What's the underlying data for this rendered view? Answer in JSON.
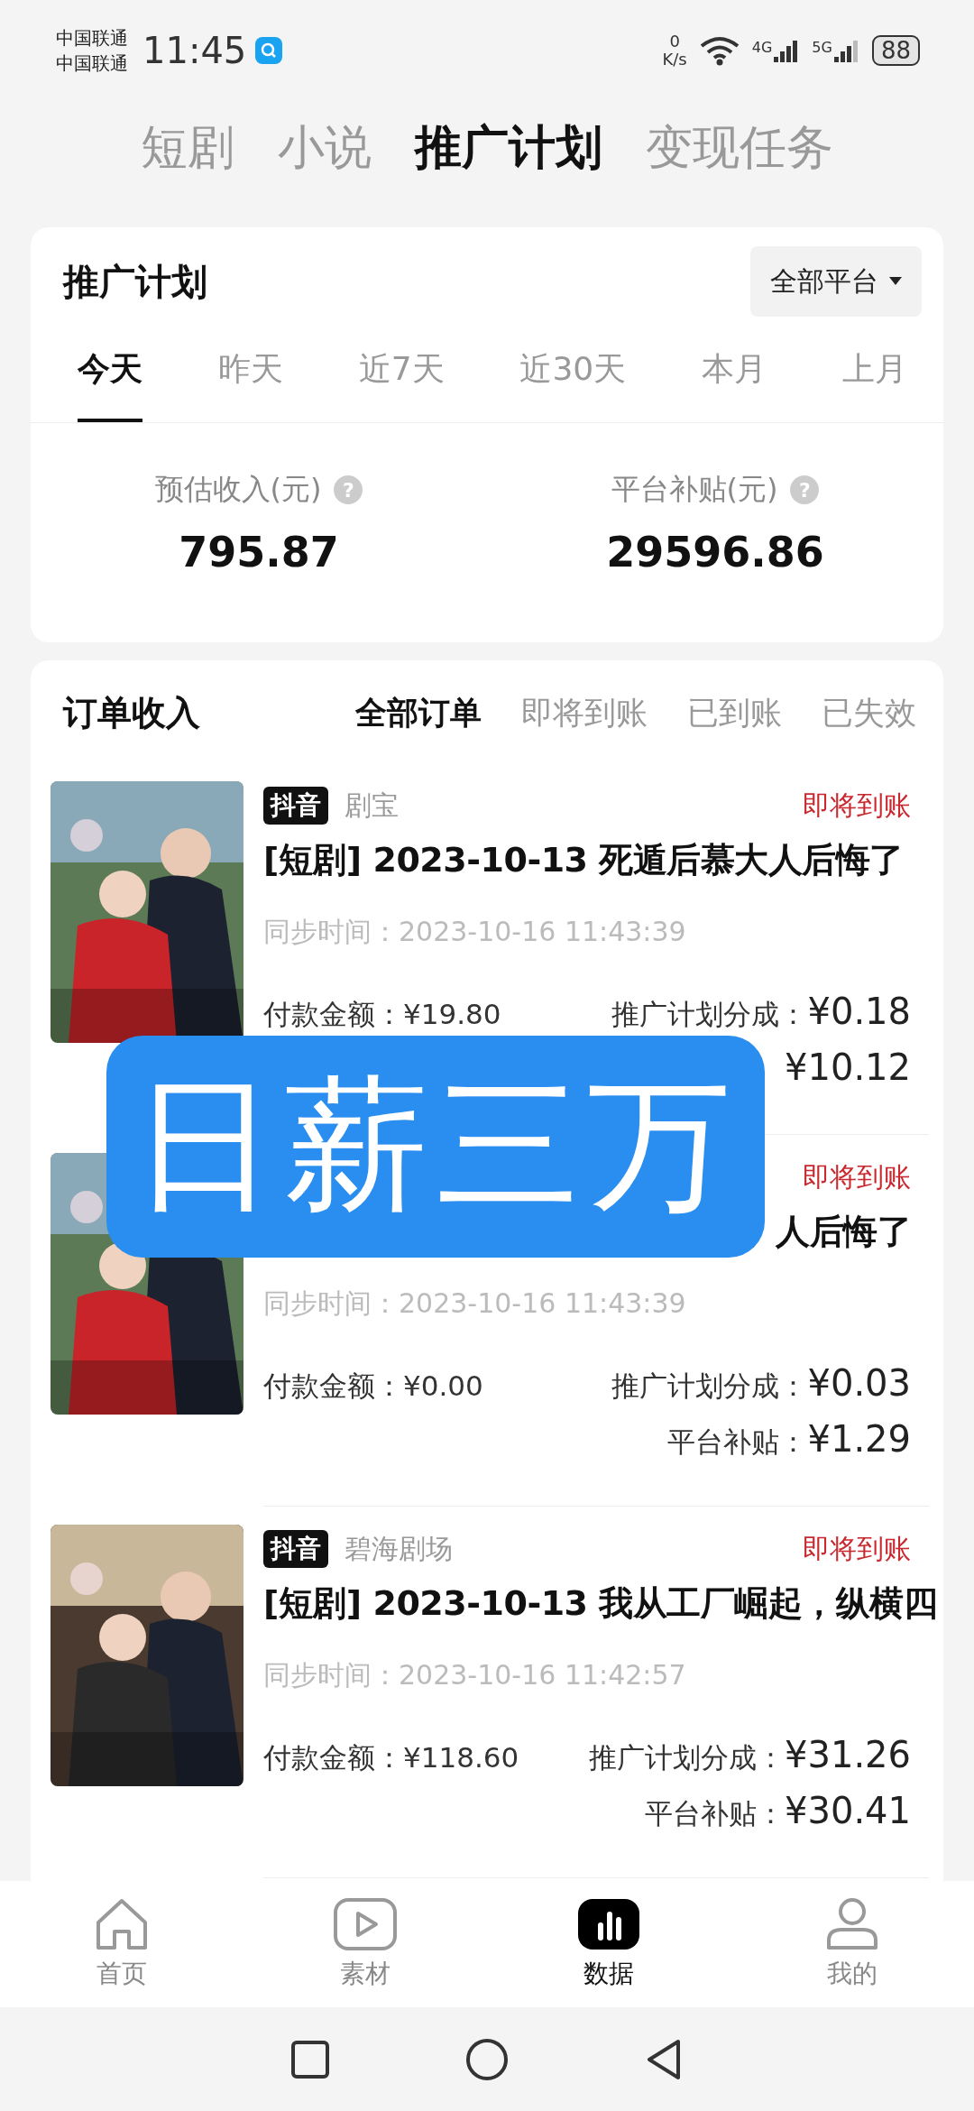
{
  "status_bar": {
    "carriers": [
      "中国联通",
      "中国联通"
    ],
    "time": "11:45",
    "net_speed": [
      "0",
      "K/s"
    ],
    "network_labels": [
      "4G",
      "5G"
    ],
    "battery": "88"
  },
  "top_tabs": [
    {
      "label": "短剧",
      "selected": false
    },
    {
      "label": "小说",
      "selected": false
    },
    {
      "label": "推广计划",
      "selected": true
    },
    {
      "label": "变现任务",
      "selected": false
    }
  ],
  "plan_card": {
    "title": "推广计划",
    "platform_dropdown": "全部平台",
    "period_tabs": [
      {
        "label": "今天",
        "selected": true
      },
      {
        "label": "昨天",
        "selected": false
      },
      {
        "label": "近7天",
        "selected": false
      },
      {
        "label": "近30天",
        "selected": false
      },
      {
        "label": "本月",
        "selected": false
      },
      {
        "label": "上月",
        "selected": false
      }
    ],
    "stats": [
      {
        "label": "预估收入(元)",
        "help": "?",
        "value": "795.87"
      },
      {
        "label": "平台补贴(元)",
        "help": "?",
        "value": "29596.86"
      }
    ]
  },
  "orders_card": {
    "title": "订单收入",
    "filter_tabs": [
      {
        "label": "全部订单",
        "selected": true
      },
      {
        "label": "即将到账",
        "selected": false
      },
      {
        "label": "已到账",
        "selected": false
      },
      {
        "label": "已失效",
        "selected": false
      }
    ],
    "orders": [
      {
        "platform_tag": "抖音",
        "source": "剧宝",
        "status": "即将到账",
        "title": "[短剧] 2023-10-13 死遁后慕大人后悔了",
        "sync_time": "同步时间：2023-10-16 11:43:39",
        "payment_label": "付款金额：",
        "payment": "¥19.80",
        "commission_label": "推广计划分成：",
        "commission": "¥0.18",
        "subsidy": "¥10.12"
      },
      {
        "status": "即将到账",
        "title": "人后悔了",
        "title_cut_start": true,
        "sync_time": "同步时间：2023-10-16 11:43:39",
        "payment_label": "付款金额：",
        "payment": "¥0.00",
        "commission_label": "推广计划分成：",
        "commission": "¥0.03",
        "subsidy_label": "平台补贴：",
        "subsidy": "¥1.29"
      },
      {
        "platform_tag": "抖音",
        "source": "碧海剧场",
        "status": "即将到账",
        "title": "[短剧] 2023-10-13 我从工厂崛起，纵横四",
        "sync_time": "同步时间：2023-10-16 11:42:57",
        "payment_label": "付款金额：",
        "payment": "¥118.60",
        "commission_label": "推广计划分成：",
        "commission": "¥31.26",
        "subsidy_label": "平台补贴：",
        "subsidy": "¥30.41"
      }
    ]
  },
  "bottom_nav": [
    {
      "label": "首页",
      "kind": "home",
      "selected": false
    },
    {
      "label": "素材",
      "kind": "play",
      "selected": false
    },
    {
      "label": "数据",
      "kind": "chart",
      "selected": true
    },
    {
      "label": "我的",
      "kind": "person",
      "selected": false
    }
  ],
  "overlay_banner": "日薪三万"
}
